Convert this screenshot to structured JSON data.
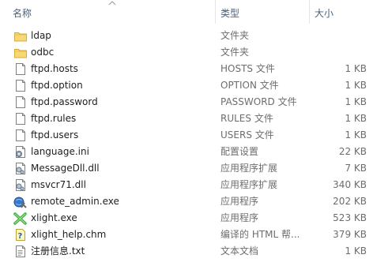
{
  "columns": {
    "name": "名称",
    "type": "类型",
    "size": "大小"
  },
  "files": [
    {
      "name": "ldap",
      "type": "文件夹",
      "size": "",
      "icon": "folder-icon"
    },
    {
      "name": "odbc",
      "type": "文件夹",
      "size": "",
      "icon": "folder-icon"
    },
    {
      "name": "ftpd.hosts",
      "type": "HOSTS 文件",
      "size": "1 KB",
      "icon": "file-icon"
    },
    {
      "name": "ftpd.option",
      "type": "OPTION 文件",
      "size": "1 KB",
      "icon": "file-icon"
    },
    {
      "name": "ftpd.password",
      "type": "PASSWORD 文件",
      "size": "1 KB",
      "icon": "file-icon"
    },
    {
      "name": "ftpd.rules",
      "type": "RULES 文件",
      "size": "1 KB",
      "icon": "file-icon"
    },
    {
      "name": "ftpd.users",
      "type": "USERS 文件",
      "size": "1 KB",
      "icon": "file-icon"
    },
    {
      "name": "language.ini",
      "type": "配置设置",
      "size": "22 KB",
      "icon": "settings-file-icon"
    },
    {
      "name": "MessageDll.dll",
      "type": "应用程序扩展",
      "size": "7 KB",
      "icon": "dll-icon"
    },
    {
      "name": "msvcr71.dll",
      "type": "应用程序扩展",
      "size": "340 KB",
      "icon": "dll-icon"
    },
    {
      "name": "remote_admin.exe",
      "type": "应用程序",
      "size": "202 KB",
      "icon": "remote-admin-app-icon"
    },
    {
      "name": "xlight.exe",
      "type": "应用程序",
      "size": "523 KB",
      "icon": "xlight-app-icon"
    },
    {
      "name": "xlight_help.chm",
      "type": "编译的 HTML 帮...",
      "size": "379 KB",
      "icon": "help-file-icon"
    },
    {
      "name": "注册信息.txt",
      "type": "文本文档",
      "size": "1 KB",
      "icon": "text-file-icon"
    }
  ]
}
